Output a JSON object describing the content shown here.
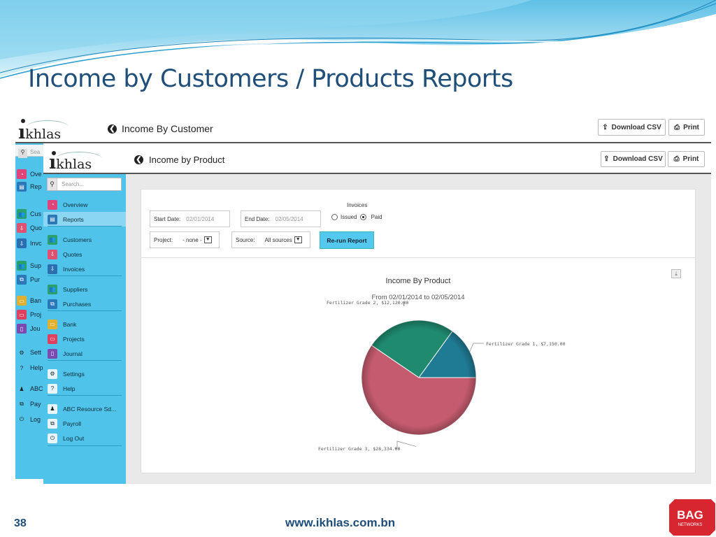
{
  "slide": {
    "title": "Income by Customers / Products Reports",
    "page_number": "38",
    "url": "www.ikhlas.com.bn",
    "brand_badge": {
      "line1": "BAG",
      "line2": "NETWORKS",
      "color": "#d7262f"
    }
  },
  "back_app": {
    "logo": "ikhlas",
    "page_title": "Income By Customer",
    "buttons": {
      "download_csv": "Download CSV",
      "print": "Print"
    },
    "search_placeholder": "Sea",
    "nav": [
      {
        "label": "Ove",
        "icon": "gauge-icon",
        "color": "#e0447a"
      },
      {
        "label": "Rep",
        "icon": "report-icon",
        "color": "#2a78b8"
      },
      {
        "label": "Cus",
        "icon": "users-icon",
        "color": "#2aa06a"
      },
      {
        "label": "Quo",
        "icon": "quote-icon",
        "color": "#e05070"
      },
      {
        "label": "Invc",
        "icon": "invoice-icon",
        "color": "#2a6fb0"
      },
      {
        "label": "Sup",
        "icon": "users-icon",
        "color": "#2aa06a"
      },
      {
        "label": "Pur",
        "icon": "purchase-icon",
        "color": "#2a78b8"
      },
      {
        "label": "Ban",
        "icon": "bank-icon",
        "color": "#e0b030"
      },
      {
        "label": "Proj",
        "icon": "project-icon",
        "color": "#e04060"
      },
      {
        "label": "Jou",
        "icon": "journal-icon",
        "color": "#7a4ab0"
      },
      {
        "label": "Sett",
        "icon": "gear-icon",
        "color": "#333333"
      },
      {
        "label": "Help",
        "icon": "help-icon",
        "color": "#333333"
      },
      {
        "label": "ABC",
        "icon": "user-icon",
        "color": "#333333"
      },
      {
        "label": "Pay",
        "icon": "payroll-icon",
        "color": "#333333"
      },
      {
        "label": "Log",
        "icon": "power-icon",
        "color": "#333333"
      }
    ]
  },
  "front_app": {
    "logo": "ikhlas",
    "page_title": "Income by Product",
    "buttons": {
      "download_csv": "Download CSV",
      "print": "Print"
    },
    "search_placeholder": "Search...",
    "nav": [
      {
        "label": "Overview",
        "icon": "gauge-icon",
        "color": "#e0447a",
        "active": false
      },
      {
        "label": "Reports",
        "icon": "report-icon",
        "color": "#2a78b8",
        "active": true
      },
      {
        "label": "Customers",
        "icon": "users-icon",
        "color": "#2aa06a",
        "active": false
      },
      {
        "label": "Quotes",
        "icon": "quote-icon",
        "color": "#e05070",
        "active": false
      },
      {
        "label": "Invoices",
        "icon": "invoice-icon",
        "color": "#2a6fb0",
        "active": false
      },
      {
        "label": "Suppliers",
        "icon": "users-icon",
        "color": "#2aa06a",
        "active": false
      },
      {
        "label": "Purchases",
        "icon": "purchase-icon",
        "color": "#2a78b8",
        "active": false
      },
      {
        "label": "Bank",
        "icon": "bank-icon",
        "color": "#e0b030",
        "active": false
      },
      {
        "label": "Projects",
        "icon": "project-icon",
        "color": "#e04060",
        "active": false
      },
      {
        "label": "Journal",
        "icon": "journal-icon",
        "color": "#7a4ab0",
        "active": false
      },
      {
        "label": "Settings",
        "icon": "gear-icon",
        "color": "#333333",
        "active": false
      },
      {
        "label": "Help",
        "icon": "help-icon",
        "color": "#333333",
        "active": false
      },
      {
        "label": "ABC Resource Sd...",
        "icon": "user-icon",
        "color": "#333333",
        "active": false
      },
      {
        "label": "Payroll",
        "icon": "payroll-icon",
        "color": "#333333",
        "active": false
      },
      {
        "label": "Log Out",
        "icon": "power-icon",
        "color": "#333333",
        "active": false
      }
    ],
    "filters": {
      "start_date_label": "Start Date:",
      "start_date_value": "02/01/2014",
      "end_date_label": "End Date:",
      "end_date_value": "02/05/2014",
      "invoices_label": "Invoices",
      "issued_label": "Issued",
      "paid_label": "Paid",
      "selected_invoice_status": "Paid",
      "project_label": "Project:",
      "project_value": "- none -",
      "source_label": "Source:",
      "source_value": "All sources",
      "rerun_label": "Re-run Report"
    }
  },
  "chart_data": {
    "type": "pie",
    "title": "Income By Product",
    "subtitle": "From 02/01/2014 to 02/05/2014",
    "slices": [
      {
        "name": "Fertilizer Grade 1",
        "value": 7150.0,
        "label": "Fertilizer Grade 1, $7,150.00",
        "color": "#1f7a94"
      },
      {
        "name": "Fertilizer Grade 2",
        "value": 12120.0,
        "label": "Fertilizer Grade 2, $12,120.00",
        "color": "#1f8a6e"
      },
      {
        "name": "Fertilizer Grade 3",
        "value": 28334.0,
        "label": "Fertilizer Grade 3, $28,334.00",
        "color": "#c45b6e"
      }
    ]
  }
}
